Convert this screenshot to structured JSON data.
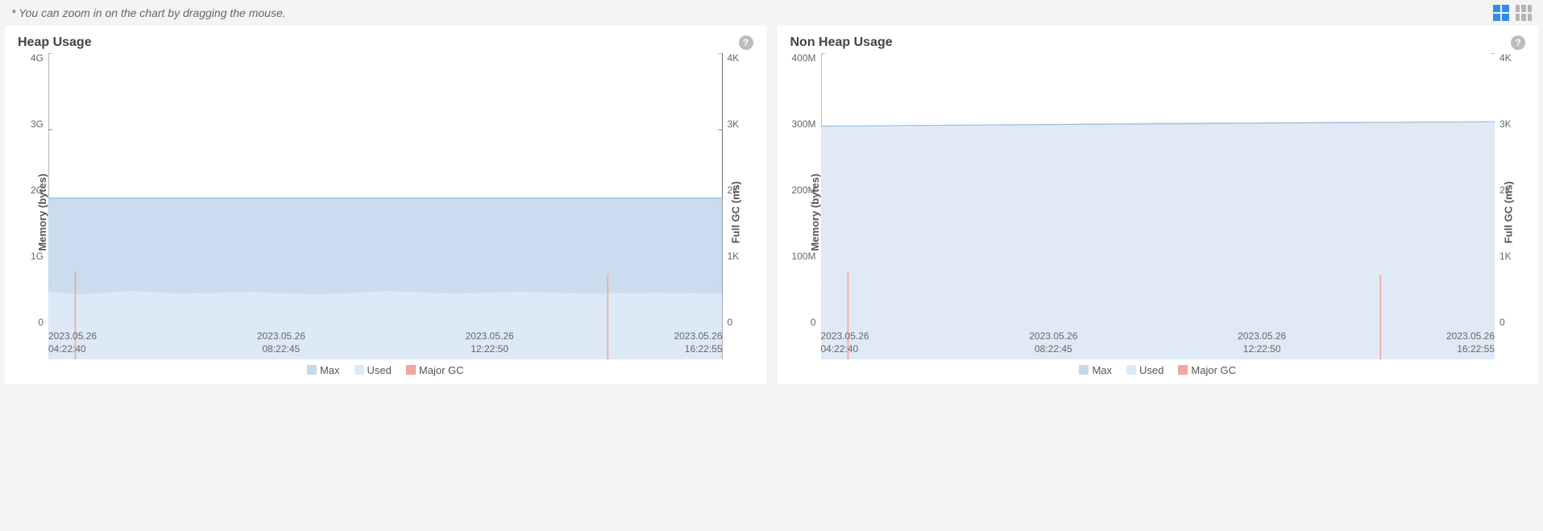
{
  "hint": "* You can zoom in on the chart by dragging the mouse.",
  "panels": [
    {
      "title": "Heap Usage"
    },
    {
      "title": "Non Heap Usage"
    }
  ],
  "legend": {
    "max": "Max",
    "used": "Used",
    "gc": "Major GC"
  },
  "axis_labels": {
    "left": "Memory (bytes)",
    "right": "Full GC (ms)"
  },
  "chart_data": [
    {
      "type": "area",
      "title": "Heap Usage",
      "y_left": {
        "label": "Memory (bytes)",
        "ticks": [
          "4G",
          "3G",
          "2G",
          "1G",
          "0"
        ],
        "range_bytes": [
          0,
          4000000000
        ]
      },
      "y_right": {
        "label": "Full GC (ms)",
        "ticks": [
          "4K",
          "3K",
          "2K",
          "1K",
          "0"
        ],
        "range_ms": [
          0,
          4000
        ]
      },
      "x_ticks": [
        {
          "date": "2023.05.26",
          "time": "04:22:40"
        },
        {
          "date": "2023.05.26",
          "time": "08:22:45"
        },
        {
          "date": "2023.05.26",
          "time": "12:22:50"
        },
        {
          "date": "2023.05.26",
          "time": "16:22:55"
        }
      ],
      "series": [
        {
          "name": "Max",
          "values_bytes": [
            2100000000,
            2100000000,
            2100000000,
            2100000000
          ]
        },
        {
          "name": "Used",
          "values_bytes": [
            880000000,
            860000000,
            870000000,
            860000000
          ]
        }
      ],
      "major_gc_events_ms": [
        {
          "x_frac": 0.04,
          "value": 1150
        },
        {
          "x_frac": 0.83,
          "value": 1100
        }
      ]
    },
    {
      "type": "area",
      "title": "Non Heap Usage",
      "y_left": {
        "label": "Memory (bytes)",
        "ticks": [
          "400M",
          "300M",
          "200M",
          "100M",
          "0"
        ],
        "range_bytes": [
          0,
          400000000
        ]
      },
      "y_right": {
        "label": "Full GC (ms)",
        "ticks": [
          "4K",
          "3K",
          "2K",
          "1K",
          "0"
        ],
        "range_ms": [
          0,
          4000
        ]
      },
      "x_ticks": [
        {
          "date": "2023.05.26",
          "time": "04:22:40"
        },
        {
          "date": "2023.05.26",
          "time": "08:22:45"
        },
        {
          "date": "2023.05.26",
          "time": "12:22:50"
        },
        {
          "date": "2023.05.26",
          "time": "16:22:55"
        }
      ],
      "series": [
        {
          "name": "Max",
          "values_bytes": [
            305000000,
            307000000,
            309000000,
            310000000
          ]
        },
        {
          "name": "Used",
          "values_bytes": [
            305000000,
            307000000,
            309000000,
            310000000
          ]
        }
      ],
      "major_gc_events_ms": [
        {
          "x_frac": 0.04,
          "value": 1150
        },
        {
          "x_frac": 0.83,
          "value": 1100
        }
      ]
    }
  ]
}
